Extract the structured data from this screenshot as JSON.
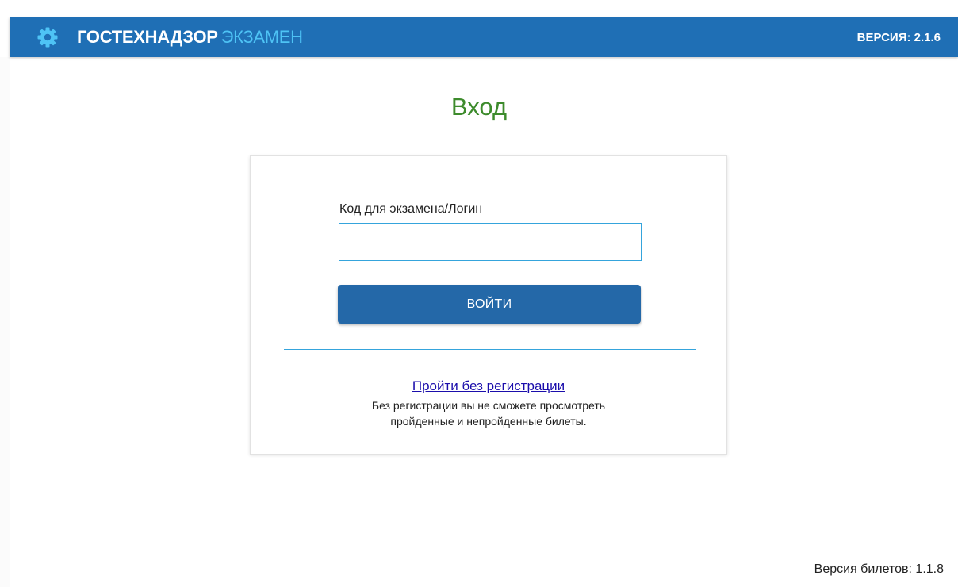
{
  "header": {
    "brand_main": "ГОСТЕХНАДЗОР",
    "brand_accent": "ЭКЗАМЕН",
    "version": "ВЕРСИЯ: 2.1.6",
    "logo_icon": "gear-icon",
    "colors": {
      "bar": "#1f6fb5",
      "accent": "#4ec3f5"
    }
  },
  "page": {
    "title": "Вход",
    "title_color": "#3d8b2c"
  },
  "login_form": {
    "label": "Код для экзамена/Логин",
    "input_value": "",
    "submit_label": "ВОЙТИ",
    "guest_link": "Пройти без регистрации",
    "guest_note_line1": "Без регистрации вы не сможете просмотреть",
    "guest_note_line2": "пройденные и непройденные билеты."
  },
  "footer": {
    "tickets_version": "Версия билетов: 1.1.8"
  }
}
